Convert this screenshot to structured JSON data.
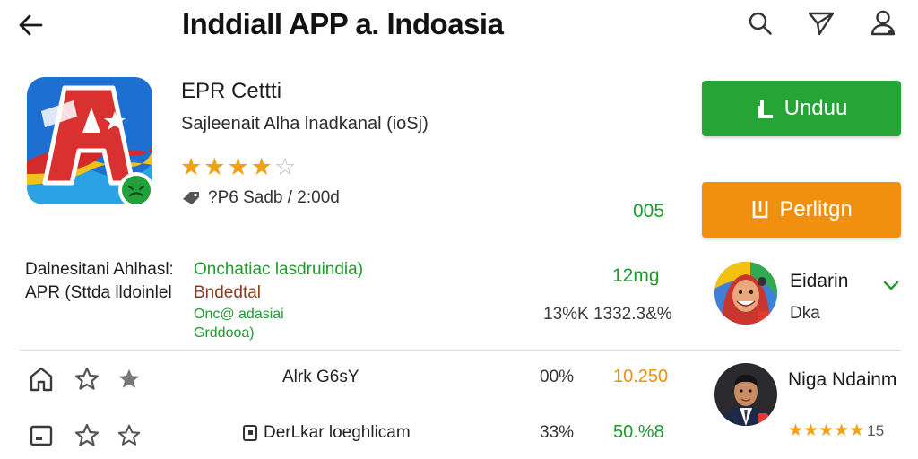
{
  "header": {
    "title": "Inddiall APP a. Indoasia",
    "icons": {
      "back": "arrow-left-icon",
      "search": "search-icon",
      "share": "send-icon",
      "profile": "account-icon"
    }
  },
  "app": {
    "name": "EPR Cettti",
    "developer": "Sajleenait Alha lnadkanal (ioSj)",
    "rating_stars": 4,
    "rating_max": 5,
    "meta": "?P6 Sadb / 2:00d",
    "green_count": "005"
  },
  "buttons": {
    "download_label": "Unduu",
    "protect_label": "Perlitgn"
  },
  "colors": {
    "accent_green": "#26a536",
    "accent_orange": "#f0900e",
    "star": "#f2a114"
  },
  "details": {
    "left_line1": "Dalnesitani Ahlhasl:",
    "left_line2": "APR (Sttda lldoinlel",
    "mid_line1": "Onchatiac lasdruindia)",
    "mid_line2": "Bndedtal",
    "mid_line3": "Onc@ adasiai",
    "mid_line4": "Grddooa)",
    "size": "12mg",
    "stat": "13%K  1332.3&%"
  },
  "reviews": [
    {
      "name": "Eidarin",
      "sub": "Dka"
    },
    {
      "name": "Niga Ndainm",
      "stars": 5,
      "count": "15"
    }
  ],
  "rows": [
    {
      "text": "Alrk G6sY",
      "pct": "00%",
      "value": "10.250",
      "value_color": "#f0900e",
      "icon": "home-icon"
    },
    {
      "text": "DerLkar loeghlicam",
      "pct": "33%",
      "value": "50.%8",
      "value_color": "#1f9a2e",
      "icon": "calendar-icon"
    }
  ]
}
